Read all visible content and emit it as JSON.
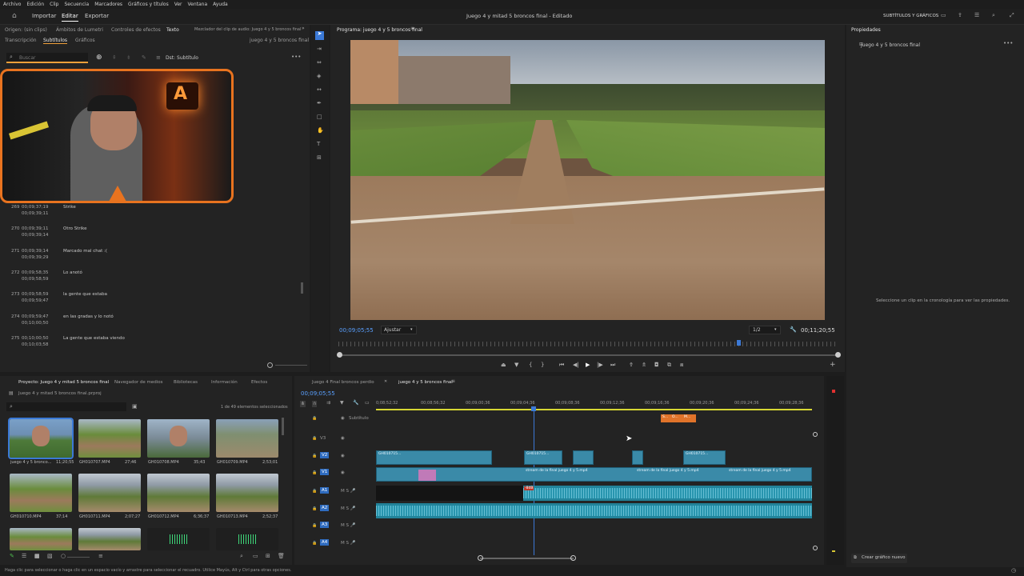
{
  "menu": [
    "Archivo",
    "Edición",
    "Clip",
    "Secuencia",
    "Marcadores",
    "Gráficos y títulos",
    "Ver",
    "Ventana",
    "Ayuda"
  ],
  "header": {
    "tabs": [
      "Importar",
      "Editar",
      "Exportar"
    ],
    "title": "Juego 4 y mitad 5 broncos final - Editado",
    "workspace": "SUBTÍTULOS Y GRÁFICOS"
  },
  "source_panel": {
    "tabs": [
      "Origen: (sin clips)",
      "Ámbitos de Lumetri",
      "Controles de efectos",
      "Texto",
      "Mezclador del clip de audio: Juego 4 y 5 broncos final"
    ],
    "subtabs": [
      "Transcripción",
      "Subtítulos",
      "Gráficos"
    ],
    "sequence_name": "juego 4 y 5 broncos final",
    "search_placeholder": "Buscar",
    "track_label": "Dst: Subtítulo",
    "webcam_overlay_label": "A",
    "captions": [
      {
        "num": "269",
        "in": "00;09;37;19",
        "out": "00;09;39;11",
        "text": "Strike"
      },
      {
        "num": "270",
        "in": "00;09;39;11",
        "out": "00;09;39;14",
        "text": "Otro Strike"
      },
      {
        "num": "271",
        "in": "00;09;39;14",
        "out": "00;09;39;29",
        "text": "Marcado mal chat :("
      },
      {
        "num": "272",
        "in": "00;09;58;35",
        "out": "00;09;58;59",
        "text": "Lo anotó"
      },
      {
        "num": "273",
        "in": "00;09;58;59",
        "out": "00;09;59;47",
        "text": "la gente que estaba"
      },
      {
        "num": "274",
        "in": "00;09;59;47",
        "out": "00;10;00;50",
        "text": "en las gradas y lo notó"
      },
      {
        "num": "275",
        "in": "00;10;00;50",
        "out": "00;10;03;58",
        "text": "La gente que estaba viendo"
      }
    ]
  },
  "program_monitor": {
    "title": "Programa: juego 4 y 5 broncos final",
    "timecode": "00;09;05;55",
    "fit": "Ajustar",
    "resolution": "1/2",
    "duration": "00;11;20;55",
    "playhead_fraction": 0.8
  },
  "properties_panel": {
    "title": "Propiedades",
    "sequence": "juego 4 y 5 broncos final",
    "empty_msg": "Seleccione un clip en la cronología para ver las propiedades.",
    "new_graphic": "Crear gráfico nuevo"
  },
  "project_panel": {
    "tabs": [
      "Proyecto: Juego 4 y mitad 5 broncos final",
      "Navegador de medios",
      "Bibliotecas",
      "Información",
      "Efectos"
    ],
    "project_file": "Juego 4 y mitad 5 broncos final.prproj",
    "count": "1 de 49 elementos seleccionados",
    "items": [
      {
        "name": "juego 4 y 5 bronco...",
        "dur": "11;20;55",
        "kind": "face"
      },
      {
        "name": "GH010707.MP4",
        "dur": "27;46",
        "kind": "field"
      },
      {
        "name": "GH010708.MP4",
        "dur": "35;43",
        "kind": "face2"
      },
      {
        "name": "GH010709.MP4",
        "dur": "2;53;01",
        "kind": "bat"
      },
      {
        "name": "GH010710.MP4",
        "dur": "37;14",
        "kind": "field"
      },
      {
        "name": "GH010711.MP4",
        "dur": "2;07;27",
        "kind": "stands"
      },
      {
        "name": "GH010712.MP4",
        "dur": "6;36;37",
        "kind": "stands"
      },
      {
        "name": "GH010713.MP4",
        "dur": "2;52;37",
        "kind": "stands"
      },
      {
        "name": "",
        "dur": "",
        "kind": "field"
      },
      {
        "name": "",
        "dur": "",
        "kind": "stands"
      },
      {
        "name": "",
        "dur": "",
        "kind": "audio"
      },
      {
        "name": "",
        "dur": "",
        "kind": "audio"
      }
    ]
  },
  "timeline": {
    "tabs": [
      "Juego 4 Final broncos perdio",
      "juego 4 y 5 broncos final"
    ],
    "timecode": "00;09;05;55",
    "ruler": [
      "0;08;52;32",
      "00;08;56;32",
      "00;09;00;36",
      "00;09;04;36",
      "00;09;08;36",
      "00;09;12;36",
      "00;09;16;36",
      "00;09;20;36",
      "00;09;24;36",
      "00;09;28;36"
    ],
    "tracks": [
      "Subtítulo",
      "V3",
      "V2",
      "V1",
      "A1",
      "A2",
      "A3",
      "A4"
    ],
    "caption_clips": [
      "S...",
      "O...",
      "M..."
    ],
    "v2_label": "GH010715...",
    "v1_label": "stream de la final juego 4 y 5.mp4",
    "audio_marker": "-8dB"
  },
  "status_bar": "Haga clic para seleccionar o haga clic en un espacio vacío y arrastre para seleccionar el recuadro. Utilice Mayús, Alt y Ctrl para otras opciones."
}
